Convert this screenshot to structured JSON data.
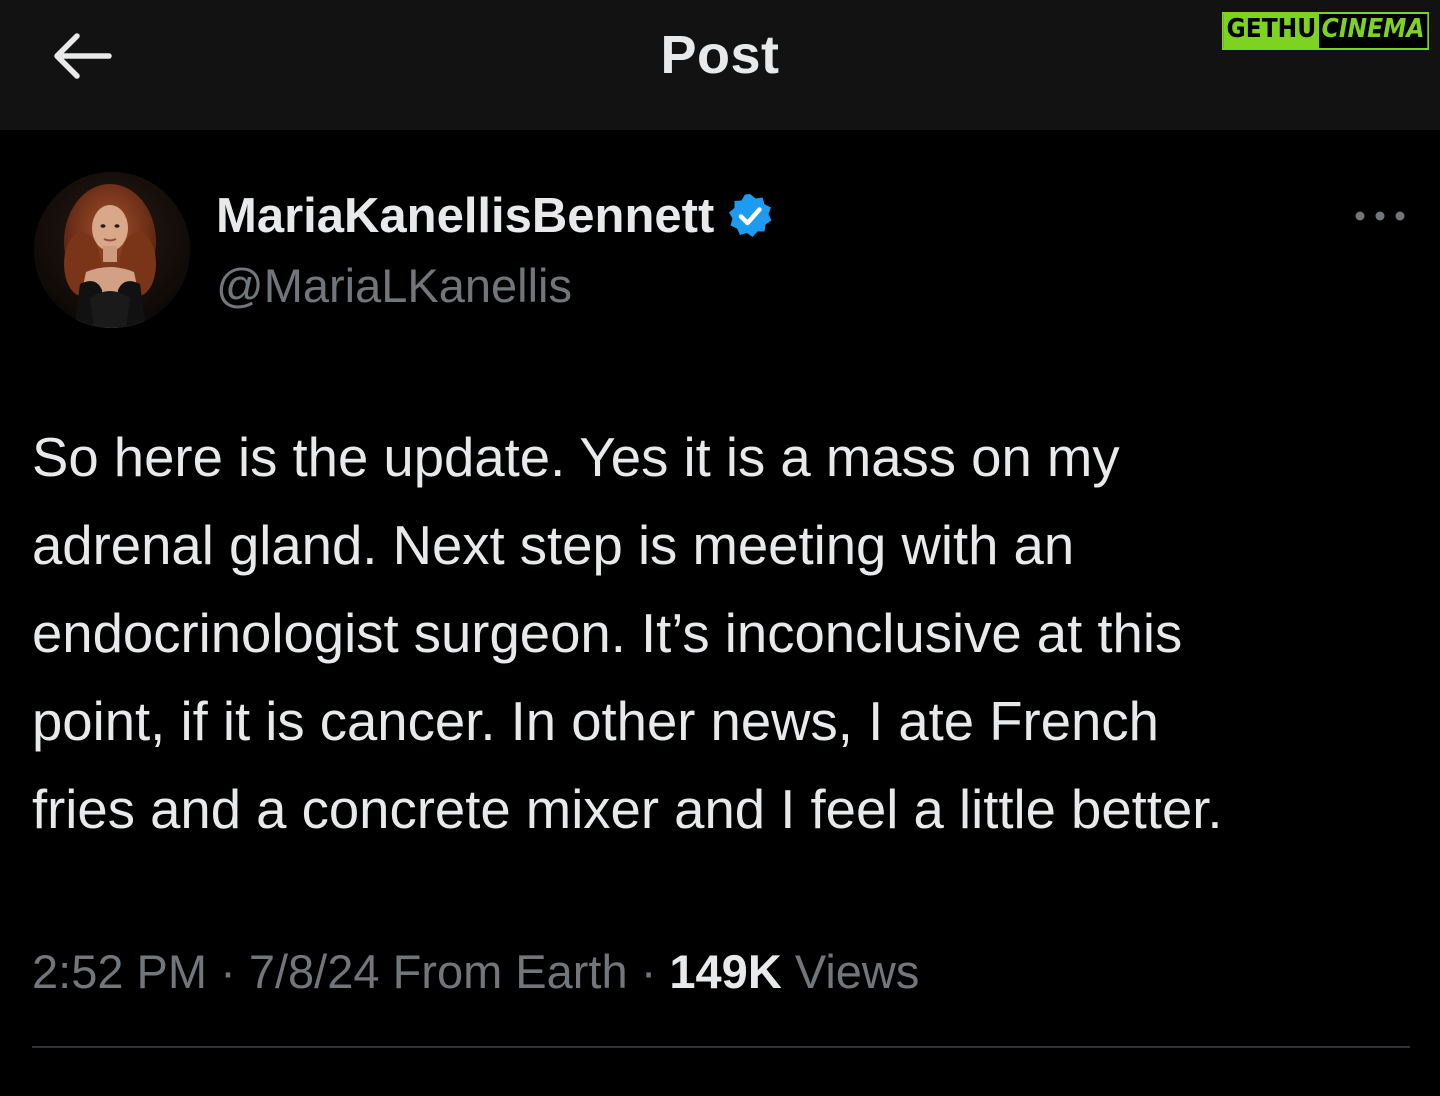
{
  "header": {
    "title": "Post",
    "back_icon": "arrow-left-icon"
  },
  "watermark": {
    "left": "GETHU",
    "right": "CINEMA",
    "accent": "#7ed321"
  },
  "author": {
    "display_name": "MariaKanellisBennett",
    "handle": "@MariaLKanellis",
    "verified": true,
    "verified_color": "#1d9bf0"
  },
  "post": {
    "text": "So here is the update. Yes it is a mass on my\nadrenal gland. Next step is meeting with an\nendocrinologist surgeon. It’s inconclusive at this\npoint, if it is cancer. In other news, I ate French\nfries and a concrete mixer and I feel a little better.",
    "time": "2:52 PM",
    "date": "7/8/24",
    "source": "From Earth",
    "separator": "·",
    "views_count": "149K",
    "views_label": "Views"
  },
  "colors": {
    "background": "#000000",
    "header_bg": "#121212",
    "primary_text": "#e7e9ea",
    "secondary_text": "#71767b",
    "divider": "#2f3336"
  }
}
